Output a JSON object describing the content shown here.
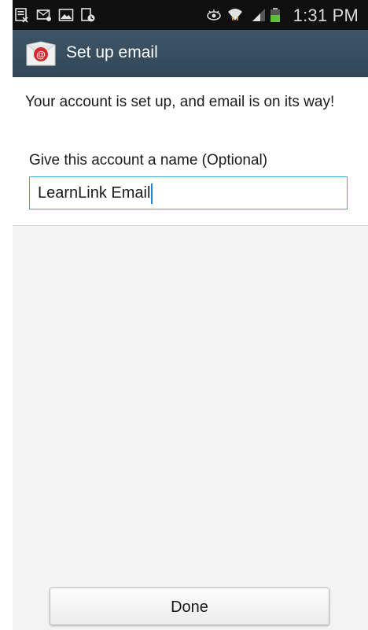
{
  "status_bar": {
    "time": "1:31 PM",
    "left_icons": [
      "notification-news-icon",
      "email-notification-icon",
      "gallery-notification-icon",
      "download-complete-icon"
    ],
    "right_icons": [
      "smart-stay-eye-icon",
      "wifi-icon",
      "signal-icon",
      "battery-icon"
    ]
  },
  "action_bar": {
    "title": "Set up email",
    "icon": "email-app-icon",
    "color": "#3a5063"
  },
  "form": {
    "message": "Your account is set up, and email is on its way!",
    "name_label": "Give this account a name (Optional)",
    "name_value": "LearnLink Email"
  },
  "footer": {
    "done_label": "Done"
  },
  "colors": {
    "accent": "#46a9de",
    "status_bar_bg": "#0f0f0f",
    "battery": "#5fbf3a"
  }
}
